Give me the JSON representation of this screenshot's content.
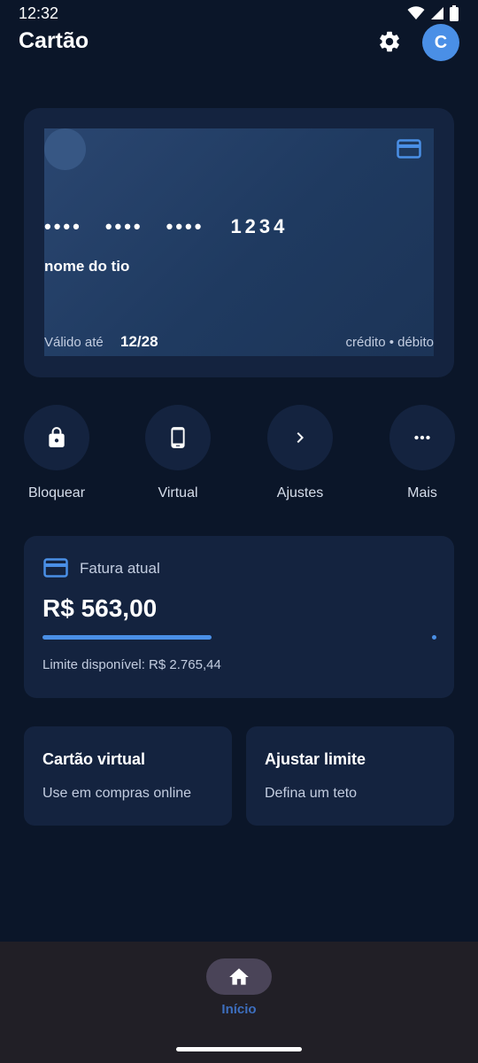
{
  "status_bar": {
    "time": "12:32"
  },
  "app_bar": {
    "title": "Cartão",
    "avatar_initial": "C"
  },
  "card": {
    "masked_groups": [
      "••••",
      "••••",
      "••••"
    ],
    "last_digits": "1234",
    "holder": "nome do tio",
    "valid_label": "Válido até",
    "valid_value": "12/28",
    "type": "crédito • débito"
  },
  "actions": [
    {
      "label": "Bloquear",
      "icon": "lock-icon"
    },
    {
      "label": "Virtual",
      "icon": "phone-icon"
    },
    {
      "label": "Ajustes",
      "icon": "chevron-right-icon"
    },
    {
      "label": "Mais",
      "icon": "more-horiz-icon"
    }
  ],
  "invoice": {
    "label": "Fatura atual",
    "amount": "R$ 563,00",
    "progress": 0.43,
    "limit_text": "Limite disponível: R$ 2.765,44"
  },
  "tiles": [
    {
      "title": "Cartão virtual",
      "subtitle": "Use em compras online"
    },
    {
      "title": "Ajustar limite",
      "subtitle": "Defina um teto"
    }
  ],
  "bottom_nav": {
    "items": [
      {
        "label": "Início",
        "icon": "home-icon",
        "selected": true
      }
    ]
  },
  "colors": {
    "background": "#0b1629",
    "surface": "#14233f",
    "accent": "#4a8fe6",
    "nav_background": "#211f26",
    "nav_pill": "#4a4458"
  }
}
